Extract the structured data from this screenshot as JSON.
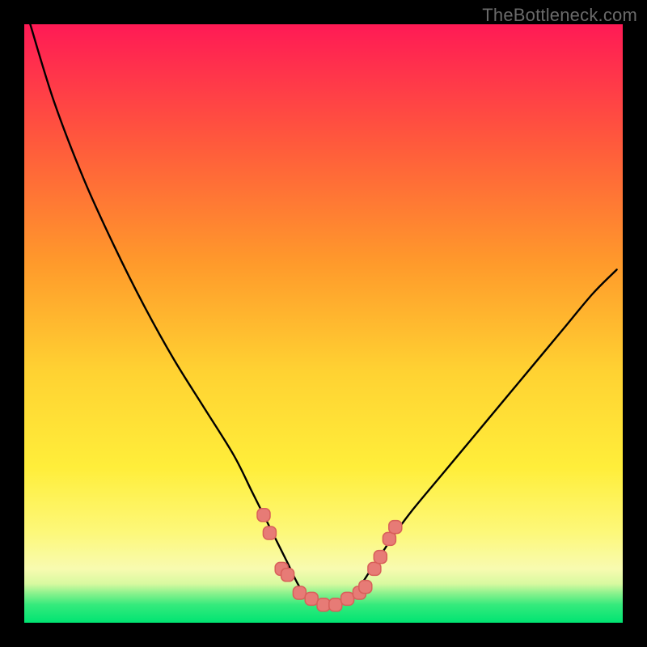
{
  "watermark": "TheBottleneck.com",
  "chart_data": {
    "type": "line",
    "title": "",
    "xlabel": "",
    "ylabel": "",
    "xlim": [
      0,
      100
    ],
    "ylim": [
      0,
      100
    ],
    "grid": false,
    "legend": false,
    "background_gradient": {
      "top": "#ff1a55",
      "mid_upper": "#ff8a2b",
      "mid": "#ffe438",
      "mid_lower": "#fff88a",
      "band": "#2df07a",
      "bottom": "#00e670"
    },
    "series": [
      {
        "name": "curve",
        "color": "#000000",
        "x": [
          1,
          5,
          10,
          15,
          20,
          25,
          30,
          35,
          38,
          40,
          42,
          44,
          46,
          48,
          50,
          52,
          54,
          56,
          58,
          60,
          62,
          65,
          70,
          75,
          80,
          85,
          90,
          95,
          99
        ],
        "y": [
          100,
          87,
          74,
          63,
          53,
          44,
          36,
          28,
          22,
          18,
          14,
          10,
          6,
          4,
          3,
          3,
          4,
          6,
          9,
          12,
          15,
          19,
          25,
          31,
          37,
          43,
          49,
          55,
          59
        ]
      }
    ],
    "markers": {
      "name": "highlight-points",
      "color_fill": "#e77b76",
      "color_stroke": "#d85f5a",
      "points": [
        {
          "x": 40,
          "y": 18
        },
        {
          "x": 41,
          "y": 15
        },
        {
          "x": 43,
          "y": 9
        },
        {
          "x": 44,
          "y": 8
        },
        {
          "x": 46,
          "y": 5
        },
        {
          "x": 48,
          "y": 4
        },
        {
          "x": 50,
          "y": 3
        },
        {
          "x": 52,
          "y": 3
        },
        {
          "x": 54,
          "y": 4
        },
        {
          "x": 56,
          "y": 5
        },
        {
          "x": 57,
          "y": 6
        },
        {
          "x": 58.5,
          "y": 9
        },
        {
          "x": 59.5,
          "y": 11
        },
        {
          "x": 61,
          "y": 14
        },
        {
          "x": 62,
          "y": 16
        }
      ]
    }
  }
}
